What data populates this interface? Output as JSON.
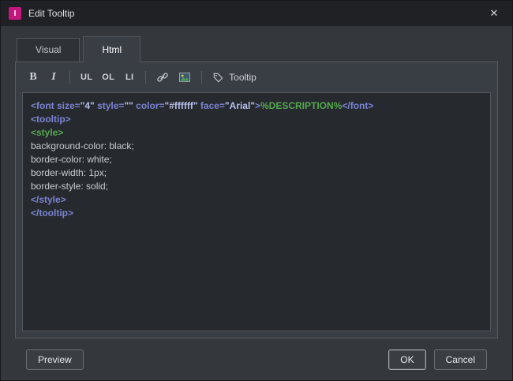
{
  "window": {
    "title": "Edit Tooltip",
    "close_glyph": "✕",
    "icon_letter": "I"
  },
  "tabs": [
    {
      "label": "Visual",
      "active": false
    },
    {
      "label": "Html",
      "active": true
    }
  ],
  "toolbar": {
    "bold_label": "B",
    "italic_label": "I",
    "ul_label": "UL",
    "ol_label": "OL",
    "li_label": "LI",
    "icons": [
      "link-icon",
      "image-icon",
      "tag-icon"
    ],
    "tooltip_label": "Tooltip"
  },
  "footer": {
    "preview_label": "Preview",
    "ok_label": "OK",
    "cancel_label": "Cancel"
  },
  "editor": {
    "syntax_colors": {
      "tag": "#7b84d4",
      "value": "#b9c0ea",
      "macro": "#55a84f",
      "plain": "#c7cbd0"
    },
    "lines": [
      [
        {
          "c": "tag",
          "t": "<font size="
        },
        {
          "c": "value",
          "t": "\"4\""
        },
        {
          "c": "tag",
          "t": " style="
        },
        {
          "c": "value",
          "t": "\"\""
        },
        {
          "c": "tag",
          "t": " color="
        },
        {
          "c": "value",
          "t": "\"#ffffff\""
        },
        {
          "c": "tag",
          "t": " face="
        },
        {
          "c": "value",
          "t": "\"Arial\""
        },
        {
          "c": "tag",
          "t": ">"
        },
        {
          "c": "macro",
          "t": "%DESCRIPTION%"
        },
        {
          "c": "tag",
          "t": "</font>"
        }
      ],
      [
        {
          "c": "tag",
          "t": "<tooltip>"
        }
      ],
      [
        {
          "c": "macro",
          "t": "<style>"
        }
      ],
      [
        {
          "c": "plain",
          "t": "background-color: black;"
        }
      ],
      [
        {
          "c": "plain",
          "t": "border-color: white;"
        }
      ],
      [
        {
          "c": "plain",
          "t": "border-width: 1px;"
        }
      ],
      [
        {
          "c": "plain",
          "t": "border-style: solid;"
        }
      ],
      [
        {
          "c": "tag",
          "t": "</style>"
        }
      ],
      [
        {
          "c": "tag",
          "t": "</tooltip>"
        }
      ]
    ]
  }
}
